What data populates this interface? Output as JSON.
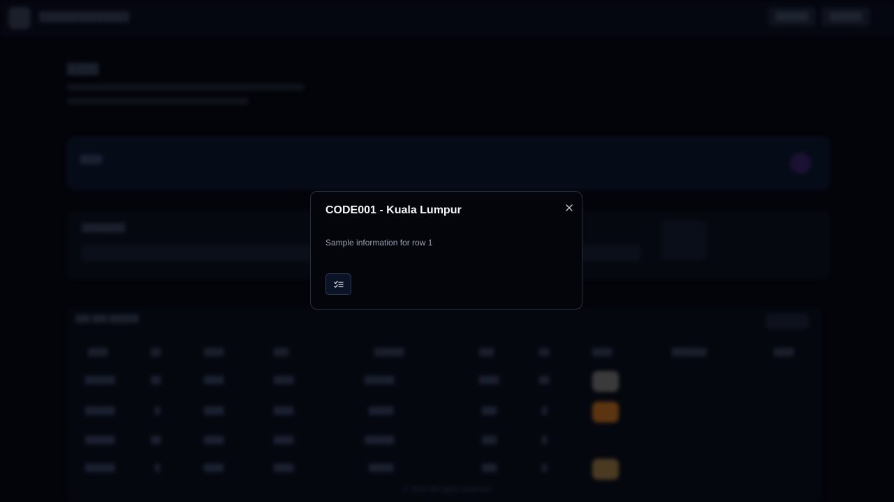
{
  "app": {
    "brand": "██████████████",
    "nav": [
      "██████",
      "██████"
    ]
  },
  "page": {
    "title": "████"
  },
  "banner": {
    "label": "████"
  },
  "filters": {
    "label": "████████"
  },
  "table": {
    "tools": "███  ███  ██████",
    "columns": [
      "████",
      "██",
      "████",
      "███",
      "██████",
      "███",
      "██",
      "████",
      "███████",
      "████"
    ],
    "rows": [
      [
        "██████",
        "██",
        "████",
        "████",
        "██████",
        "████",
        "██",
        "███████"
      ],
      [
        "██████",
        "█",
        "████",
        "████",
        "█████",
        "███",
        "█",
        "███████"
      ],
      [
        "██████",
        "██",
        "████",
        "████",
        "██████",
        "███",
        "█",
        "███████"
      ],
      [
        "██████",
        "█",
        "████",
        "████",
        "█████",
        "███",
        "█",
        "███████"
      ]
    ]
  },
  "footer": {
    "text": "© 2025 All rights reserved"
  },
  "modal": {
    "title": "CODE001 - Kuala Lumpur",
    "description": "Sample information for row 1",
    "close_icon": "close-icon",
    "action_icon": "checklist-icon"
  }
}
